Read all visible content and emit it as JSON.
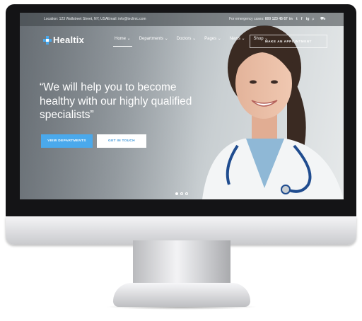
{
  "topbar": {
    "location": "Location: 123 Wallstreet Street, NY, USA",
    "email": "Email: info@teclinic.com",
    "emergency_label": "For emergency cases:",
    "emergency_phone": "800 123 45 67",
    "social": [
      "in",
      "t",
      "f",
      "ig"
    ]
  },
  "brand": {
    "name": "Healtix",
    "accent": "#4aa9ec"
  },
  "nav": {
    "items": [
      {
        "label": "Home ⌄"
      },
      {
        "label": "Departments ⌄"
      },
      {
        "label": "Doctors ⌄"
      },
      {
        "label": "Pages ⌄"
      },
      {
        "label": "News ⌄"
      },
      {
        "label": "Shop ⌄"
      }
    ],
    "cta": "MAKE AN APPOINTMENT"
  },
  "hero": {
    "headline": "“We will help you to become healthy with our highly qualified specialists”",
    "primary_button": "VIEW DEPARTMENTS",
    "secondary_button": "GET IN TOUCH",
    "active_slide": 1,
    "slide_count": 3
  },
  "icons": [
    "search-icon",
    "cart-icon",
    "logo-icon"
  ]
}
